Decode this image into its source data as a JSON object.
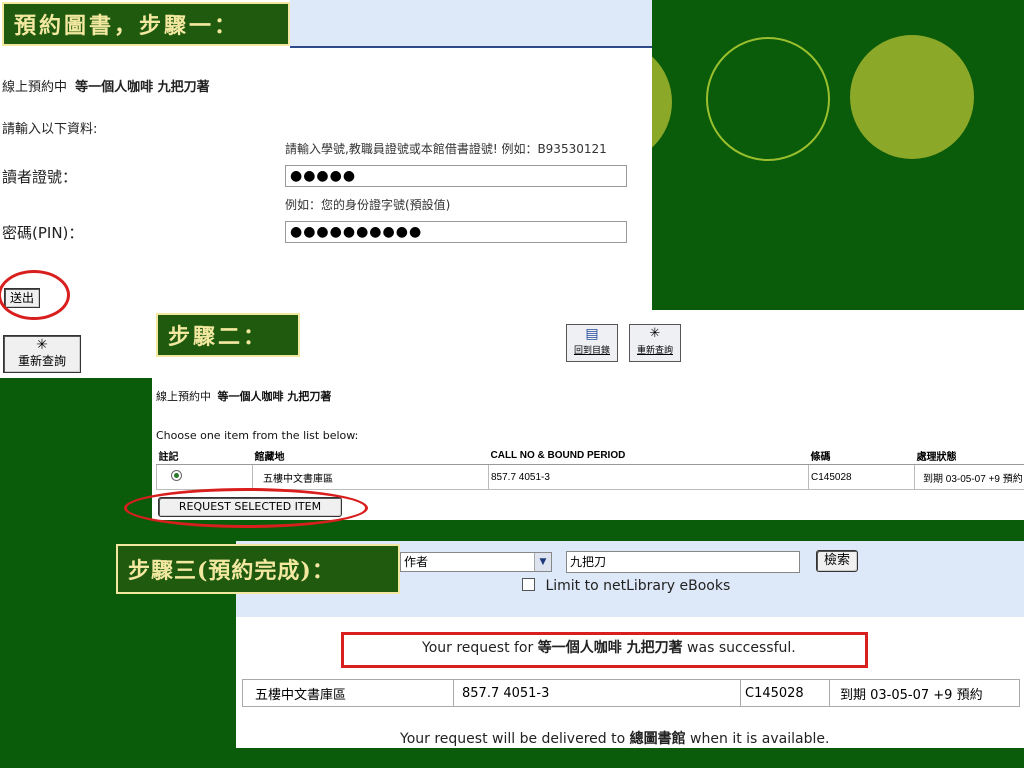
{
  "step1": {
    "label": "預約圖書，步驟一：",
    "reserve_title_prefix": "線上預約中",
    "reserve_title_book": "等一個人咖啡 九把刀著",
    "prompt": "請輸入以下資料:",
    "id_hint": "請輸入學號,教職員證號或本館借書證號! 例如：B93530121",
    "id_label": "讀者證號：",
    "id_value": "●●●●●",
    "pin_hint": "例如：您的身份證字號(預設值)",
    "pin_label": "密碼(PIN)：",
    "pin_value": "●●●●●●●●●●",
    "submit_label": "送出",
    "requery_label": "重新查詢"
  },
  "step2": {
    "label": "步驟二：",
    "back_to_catalog": "回到目錄",
    "requery": "重新查詢",
    "reserve_title_prefix": "線上預約中",
    "reserve_title_book": "等一個人咖啡 九把刀著",
    "choose_text": "Choose one item from the list below:",
    "columns": [
      "註記",
      "館藏地",
      "CALL NO & BOUND PERIOD",
      "條碼",
      "處理狀態"
    ],
    "row": [
      "五樓中文書庫區",
      "857.7 4051-3",
      "C145028",
      "到期 03-05-07 +9 預約"
    ],
    "request_button": "REQUEST SELECTED ITEM"
  },
  "step3": {
    "label": "步驟三(預約完成)：",
    "search_field_type": "作者",
    "search_value": "九把刀",
    "search_button": "檢索",
    "limit_label": "Limit to netLibrary eBooks",
    "success_prefix": "Your request for ",
    "success_book": "等一個人咖啡 九把刀著",
    "success_suffix": " was successful.",
    "row": [
      "五樓中文書庫區",
      "857.7 4051-3",
      "C145028",
      "到期 03-05-07 +9 預約"
    ],
    "delivery_prefix": "Your request will be delivered to ",
    "delivery_location": "總圖書館",
    "delivery_suffix": " when it is available."
  },
  "colors": {
    "background": "#0a5c0a",
    "label_bg": "#1f5a0e",
    "label_text": "#f2e8a0",
    "highlight_red": "#d91e1e",
    "circle_green": "#8ca828"
  }
}
